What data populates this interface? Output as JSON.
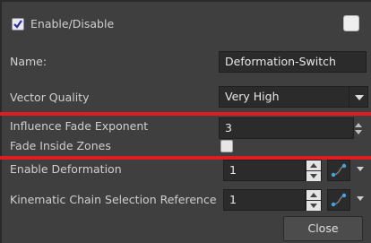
{
  "header": {
    "enable_label": "Enable/Disable",
    "enable_checked": true
  },
  "fields": {
    "name_label": "Name:",
    "name_value": "Deformation-Switch",
    "vector_quality_label": "Vector Quality",
    "vector_quality_value": "Very High",
    "influence_fade_label": "Influence Fade Exponent",
    "influence_fade_value": "3",
    "fade_inside_label": "Fade Inside Zones",
    "fade_inside_checked": false,
    "enable_deformation_label": "Enable Deformation",
    "enable_deformation_value": "1",
    "kinematic_label": "Kinematic Chain Selection Reference",
    "kinematic_value": "1"
  },
  "footer": {
    "close_label": "Close"
  },
  "colors": {
    "background": "#3f3f3f",
    "highlight": "#e01b22",
    "field": "#2b2b2b",
    "pick_icon": "#3da7e3"
  },
  "icons": [
    "checkbox-icon",
    "dropdown-arrow-icon",
    "stepper-icon",
    "function-curve-icon",
    "spin-arrows-icon"
  ]
}
